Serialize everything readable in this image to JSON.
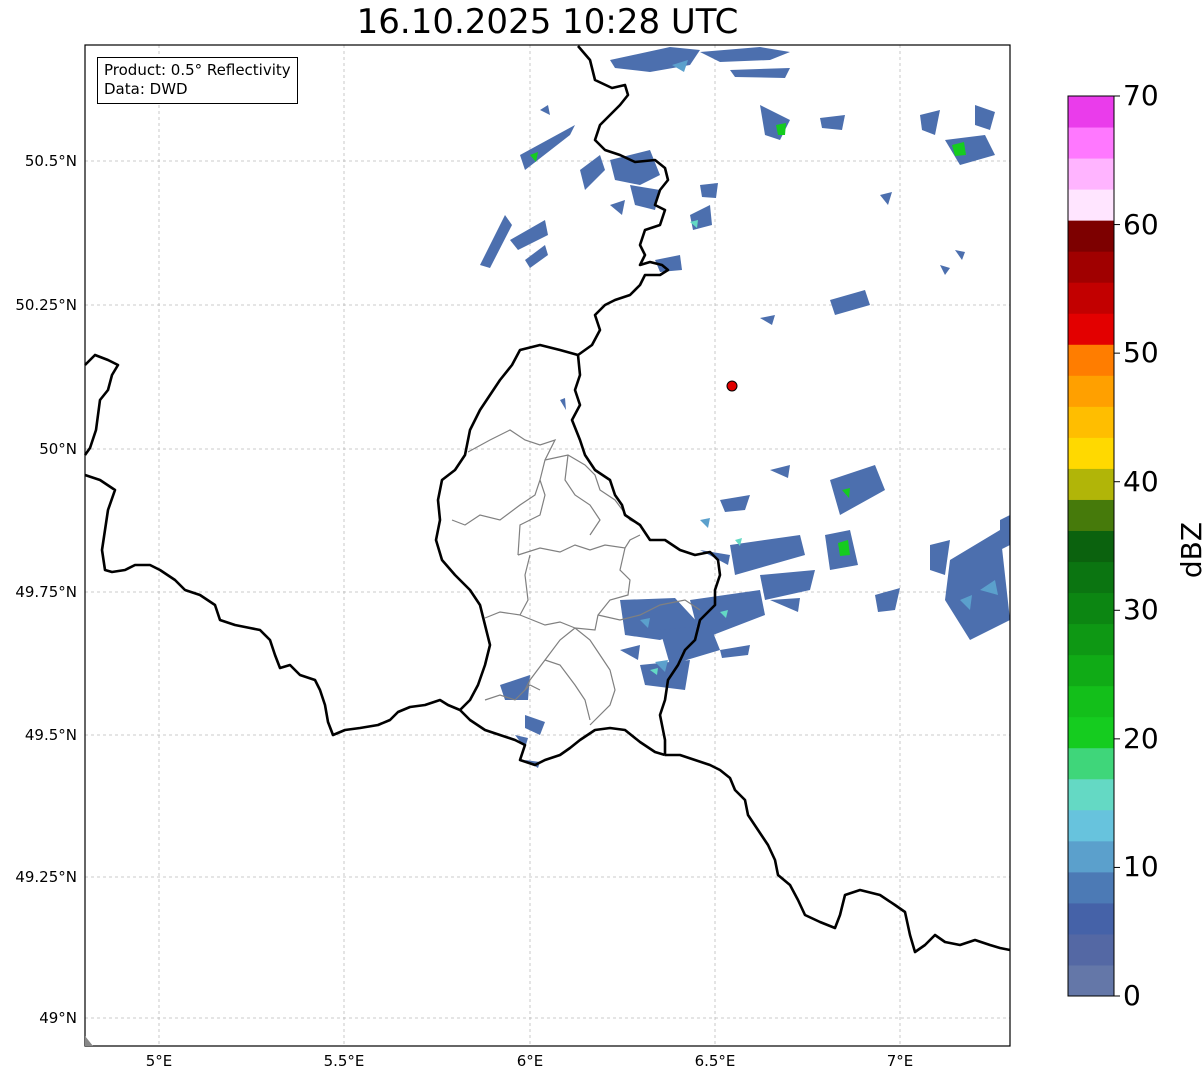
{
  "title": "16.10.2025 10:28 UTC",
  "info": {
    "product": "Product: 0.5° Reflectivity",
    "data": "Data: DWD"
  },
  "axes": {
    "lat_labels": [
      "50.5°N",
      "50.25°N",
      "50°N",
      "49.75°N",
      "49.5°N",
      "49.25°N",
      "49°N"
    ],
    "lon_labels": [
      "5°E",
      "5.5°E",
      "6°E",
      "6.5°E",
      "7°E"
    ]
  },
  "colorbar": {
    "label": "dBZ",
    "ticks": [
      "0",
      "10",
      "20",
      "30",
      "40",
      "50",
      "60",
      "70"
    ],
    "colors": [
      "#6477a8",
      "#5468a4",
      "#4562a8",
      "#4c7ab5",
      "#5ba0cc",
      "#67c3dd",
      "#64d9c4",
      "#3fd67a",
      "#15cc1f",
      "#13bf1a",
      "#10ab16",
      "#0e9814",
      "#0c8612",
      "#0b7511",
      "#0b620e",
      "#467a0b",
      "#b1b508",
      "#ffd900",
      "#ffbe00",
      "#ffa000",
      "#ff7d00",
      "#e30000",
      "#c20000",
      "#a00000",
      "#7d0000",
      "#ffe5ff",
      "#ffb4ff",
      "#ff78ff",
      "#ea3ceb"
    ]
  },
  "radar_site": {
    "color": "#e00000"
  },
  "colors": {
    "country_border": "#000000",
    "district_border": "#808080",
    "grid": "#bbbbbb"
  }
}
